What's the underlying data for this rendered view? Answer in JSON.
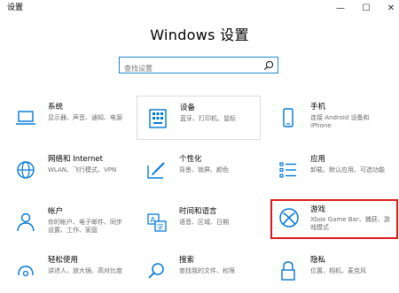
{
  "window": {
    "title": "设置",
    "controls": {
      "minimize": "—",
      "maximize": "☐",
      "close": "✕"
    }
  },
  "heading": "Windows 设置",
  "search": {
    "placeholder": "查找设置",
    "icon": "search-icon"
  },
  "categories": [
    {
      "id": "system",
      "name": "系统",
      "desc": "显示器、声音、通知、电源",
      "icon": "laptop-icon",
      "hover": false,
      "selected": false
    },
    {
      "id": "devices",
      "name": "设备",
      "desc": "蓝牙、打印机、鼠标",
      "icon": "keyboard-icon",
      "hover": true,
      "selected": false
    },
    {
      "id": "phone",
      "name": "手机",
      "desc": "连接 Android 设备和 iPhone",
      "icon": "phone-icon",
      "hover": false,
      "selected": false
    },
    {
      "id": "network",
      "name": "网络和 Internet",
      "desc": "WLAN、飞行模式、VPN",
      "icon": "globe-icon",
      "hover": false,
      "selected": false
    },
    {
      "id": "personalization",
      "name": "个性化",
      "desc": "背景、锁屏、颜色",
      "icon": "paintbrush-icon",
      "hover": false,
      "selected": false
    },
    {
      "id": "apps",
      "name": "应用",
      "desc": "卸载、默认应用、可选功能",
      "icon": "apps-list-icon",
      "hover": false,
      "selected": false
    },
    {
      "id": "accounts",
      "name": "帐户",
      "desc": "你的帐户、电子邮件、同步设置、工作、家庭",
      "icon": "person-icon",
      "hover": false,
      "selected": false
    },
    {
      "id": "time",
      "name": "时间和语言",
      "desc": "语音、区域、日期",
      "icon": "time-language-icon",
      "hover": false,
      "selected": false
    },
    {
      "id": "gaming",
      "name": "游戏",
      "desc": "Xbox Game Bar、捕获、游戏模式",
      "icon": "xbox-icon",
      "hover": false,
      "selected": true
    },
    {
      "id": "ease",
      "name": "轻松使用",
      "desc": "讲述人、放大镜、高对比度",
      "icon": "accessibility-icon",
      "hover": false,
      "selected": false
    },
    {
      "id": "search",
      "name": "搜索",
      "desc": "查找我的文件、权限",
      "icon": "magnifier-icon",
      "hover": false,
      "selected": false
    },
    {
      "id": "privacy",
      "name": "隐私",
      "desc": "位置、相机、麦克风",
      "icon": "lock-icon",
      "hover": false,
      "selected": false
    }
  ],
  "colors": {
    "accent": "#0078d7",
    "selected_border": "#e01818",
    "search_border": "#1f8bcf"
  }
}
